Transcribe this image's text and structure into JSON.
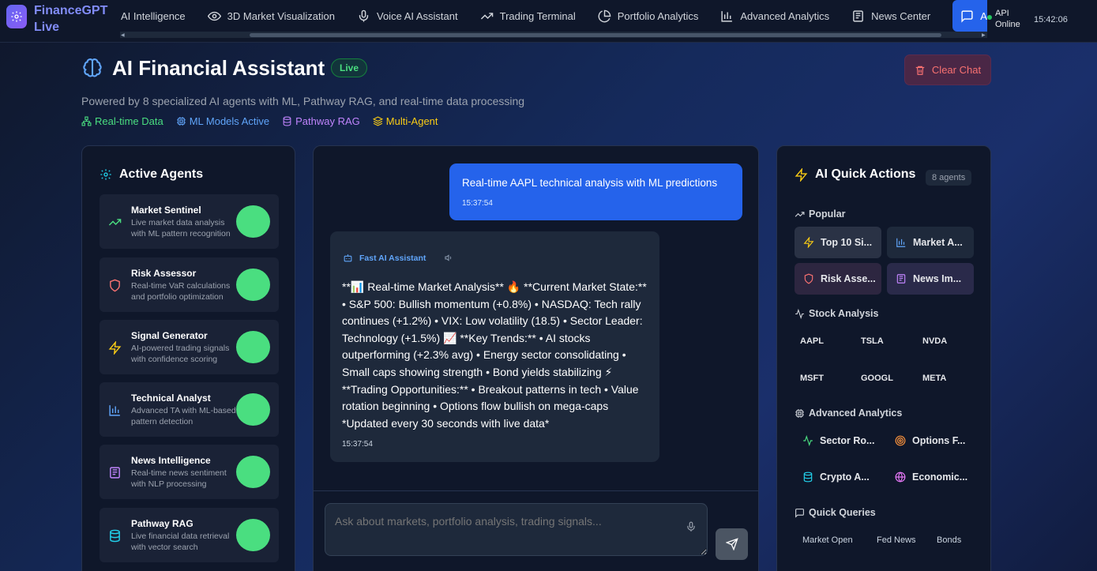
{
  "app": {
    "title": "FinanceGPT Live",
    "colors": {
      "accent": "#2563eb",
      "live": "#4ade80",
      "danger": "#f87171",
      "panel": "#0f172a"
    }
  },
  "nav": {
    "items": [
      {
        "label": "AI Intelligence",
        "icon": "none"
      },
      {
        "label": "3D Market Visualization",
        "icon": "eye-icon"
      },
      {
        "label": "Voice AI Assistant",
        "icon": "mic-icon"
      },
      {
        "label": "Trading Terminal",
        "icon": "trend-icon"
      },
      {
        "label": "Portfolio Analytics",
        "icon": "pie-icon"
      },
      {
        "label": "Advanced Analytics",
        "icon": "bar-chart-icon"
      },
      {
        "label": "News Center",
        "icon": "newspaper-icon"
      },
      {
        "label": "AI",
        "icon": "chat-icon",
        "active": true
      }
    ],
    "api_status": "API Online",
    "clock": "15:42:06"
  },
  "header": {
    "title": "AI Financial Assistant",
    "badge": "Live",
    "subtitle": "Powered by 8 specialized AI agents with ML, Pathway RAG, and real-time data processing",
    "tags": [
      {
        "label": "Real-time Data",
        "color": "#4ade80"
      },
      {
        "label": "ML Models Active",
        "color": "#60a5fa"
      },
      {
        "label": "Pathway RAG",
        "color": "#c084fc"
      },
      {
        "label": "Multi-Agent",
        "color": "#facc15"
      }
    ],
    "clear_label": "Clear Chat"
  },
  "agents_panel": {
    "title": "Active Agents",
    "agents": [
      {
        "name": "Market Sentinel",
        "desc": "Live market data analysis with ML pattern recognition",
        "icon": "trend-up-icon"
      },
      {
        "name": "Risk Assessor",
        "desc": "Real-time VaR calculations and portfolio optimization",
        "icon": "shield-icon"
      },
      {
        "name": "Signal Generator",
        "desc": "AI-powered trading signals with confidence scoring",
        "icon": "lightning-icon"
      },
      {
        "name": "Technical Analyst",
        "desc": "Advanced TA with ML-based pattern detection",
        "icon": "bar-chart-icon"
      },
      {
        "name": "News Intelligence",
        "desc": "Real-time news sentiment with NLP processing",
        "icon": "newspaper-icon"
      },
      {
        "name": "Pathway RAG",
        "desc": "Live financial data retrieval with vector search",
        "icon": "database-icon"
      }
    ]
  },
  "chat": {
    "user_message": {
      "text": "Real-time AAPL technical analysis with ML predictions",
      "time": "15:37:54"
    },
    "ai_message": {
      "sender": "Fast AI Assistant",
      "text": "**📊 Real-time Market Analysis** 🔥 **Current Market State:** • S&P 500: Bullish momentum (+0.8%) • NASDAQ: Tech rally continues (+1.2%) • VIX: Low volatility (18.5) • Sector Leader: Technology (+1.5%) 📈 **Key Trends:** • AI stocks outperforming (+2.3% avg) • Energy sector consolidating • Small caps showing strength • Bond yields stabilizing ⚡ **Trading Opportunities:** • Breakout patterns in tech • Value rotation beginning • Options flow bullish on mega-caps *Updated every 30 seconds with live data*",
      "time": "15:37:54"
    },
    "input_placeholder": "Ask about markets, portfolio analysis, trading signals..."
  },
  "quick_panel": {
    "title": "AI Quick Actions",
    "count": "8 agents",
    "popular_label": "Popular",
    "popular": [
      "Top 10 Si...",
      "Market A...",
      "Risk Asse...",
      "News Im..."
    ],
    "stock_label": "Stock Analysis",
    "tickers": [
      "AAPL",
      "TSLA",
      "NVDA",
      "MSFT",
      "GOOGL",
      "META"
    ],
    "advanced_label": "Advanced Analytics",
    "advanced": [
      "Sector Ro...",
      "Options F...",
      "Crypto A...",
      "Economic..."
    ],
    "queries_label": "Quick Queries",
    "queries": [
      "Market Open",
      "Fed News",
      "Bonds"
    ]
  }
}
